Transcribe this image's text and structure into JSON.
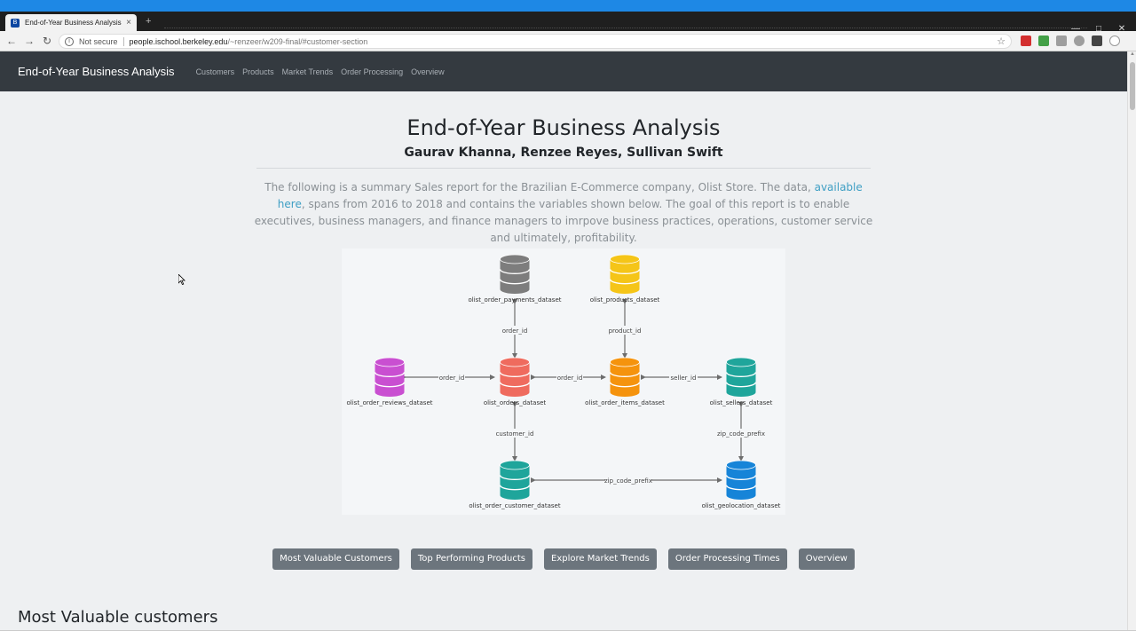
{
  "browser": {
    "tab_title": "End-of-Year Business Analysis",
    "tab_close": "×",
    "new_tab": "+",
    "security_label": "Not secure",
    "url_host": "people.ischool.berkeley.edu",
    "url_path": "/~renzeer/w209-final/#customer-section"
  },
  "navbar": {
    "brand": "End-of-Year Business Analysis",
    "links": [
      "Customers",
      "Products",
      "Market Trends",
      "Order Processing",
      "Overview"
    ]
  },
  "header": {
    "title": "End-of-Year Business Analysis",
    "authors": "Gaurav Khanna, Renzee Reyes, Sullivan Swift",
    "intro_before_link": "The following is a summary Sales report for the Brazilian E-Commerce company, Olist Store. The data, ",
    "intro_link": "available here",
    "intro_after_link": ", spans from 2016 to 2018 and contains the variables shown below. The goal of this report is to enable executives, business managers, and finance managers to imrpove business practices, operations, customer service and ultimately, profitability."
  },
  "diagram": {
    "nodes": {
      "payments": {
        "label": "olist_order_payments_dataset",
        "color": "#7d7d7d"
      },
      "products": {
        "label": "olist_products_dataset",
        "color": "#f5c518"
      },
      "reviews": {
        "label": "olist_order_reviews_dataset",
        "color": "#c94fd1"
      },
      "orders": {
        "label": "olist_orders_dataset",
        "color": "#ef6b5e"
      },
      "items": {
        "label": "olist_order_items_dataset",
        "color": "#f5930d"
      },
      "sellers": {
        "label": "olist_sellers_dataset",
        "color": "#1fa59b"
      },
      "customer": {
        "label": "olist_order_customer_dataset",
        "color": "#1fa59b"
      },
      "geolocation": {
        "label": "olist_geolocation_dataset",
        "color": "#1684d8"
      }
    },
    "edges": {
      "payments_orders": "order_id",
      "products_items": "product_id",
      "reviews_orders": "order_id",
      "orders_items": "order_id",
      "items_sellers": "seller_id",
      "orders_customer": "customer_id",
      "sellers_geolocation": "zip_code_prefix",
      "customer_geolocation": "zip_code_prefix"
    }
  },
  "buttons": [
    "Most Valuable Customers",
    "Top Performing Products",
    "Explore Market Trends",
    "Order Processing Times",
    "Overview"
  ],
  "section": {
    "heading": "Most Valuable customers"
  },
  "colors": {
    "accent": "#1e88e5",
    "navbar": "#343a40",
    "button": "#6c757d",
    "link": "#3f9fc4"
  }
}
